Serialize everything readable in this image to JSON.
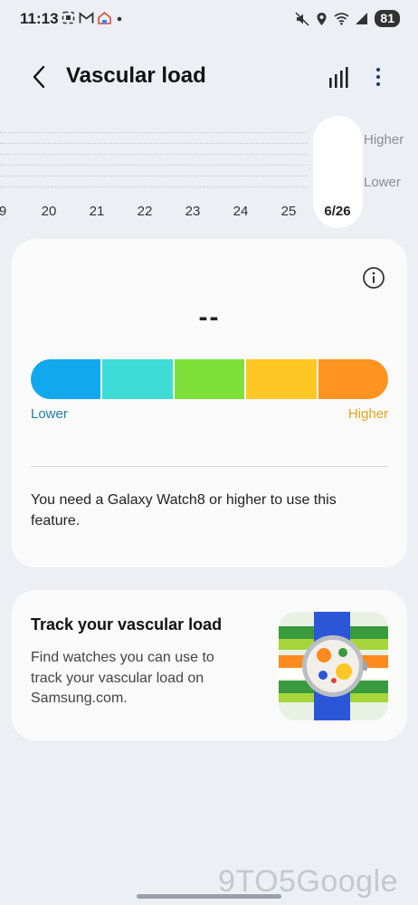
{
  "status_bar": {
    "time": "11:13",
    "battery": "81"
  },
  "app_bar": {
    "title": "Vascular load"
  },
  "timeline": {
    "legend_higher": "Higher",
    "legend_lower": "Lower",
    "dates": [
      "9",
      "20",
      "21",
      "22",
      "23",
      "24",
      "25",
      "6/26"
    ],
    "selected_date": "6/26"
  },
  "vascular_card": {
    "value": "--",
    "scale": {
      "colors": [
        "#12A8EE",
        "#3DDCD7",
        "#7FE03A",
        "#FFC726",
        "#FF9422"
      ],
      "lower_label": "Lower",
      "higher_label": "Higher",
      "lower_color": "#1B7FA8",
      "higher_color": "#E8A21D"
    },
    "notice": "You need a Galaxy Watch8 or higher to use this feature."
  },
  "track_card": {
    "title": "Track your vascular load",
    "description": "Find watches you can use to track your vascular load on Samsung.com."
  },
  "watermark": "9TO5Google"
}
